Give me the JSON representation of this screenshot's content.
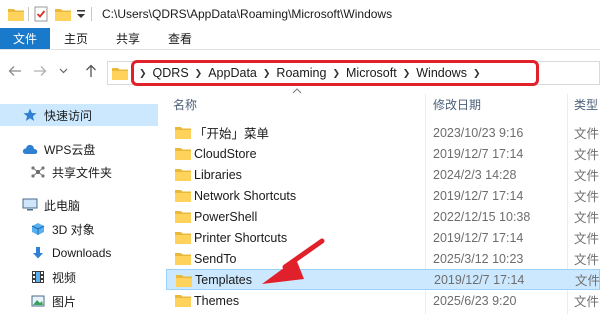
{
  "titlebar": {
    "title": "C:\\Users\\QDRS\\AppData\\Roaming\\Microsoft\\Windows",
    "icons": [
      "folder-icon",
      "properties-check-icon",
      "new-folder-icon",
      "customize-dropdown-icon"
    ]
  },
  "ribbon": {
    "tabs": [
      {
        "label": "文件",
        "active": true
      },
      {
        "label": "主页"
      },
      {
        "label": "共享"
      },
      {
        "label": "查看"
      }
    ]
  },
  "navigation": {
    "back_icon": "arrow-left-icon",
    "forward_icon": "arrow-right-icon",
    "recent_icon": "chevron-down-icon",
    "up_icon": "arrow-up-icon"
  },
  "address": {
    "crumbs": [
      "QDRS",
      "AppData",
      "Roaming",
      "Microsoft",
      "Windows"
    ],
    "highlight_color": "#e0202a"
  },
  "sidebar": {
    "items": [
      {
        "label": "快速访问",
        "icon": "star-icon"
      },
      {
        "label": "WPS云盘",
        "icon": "cloud-icon"
      },
      {
        "label": "共享文件夹",
        "icon": "share-icon"
      },
      {
        "label": "此电脑",
        "icon": "computer-icon"
      },
      {
        "label": "3D 对象",
        "icon": "cube-icon"
      },
      {
        "label": "Downloads",
        "icon": "download-icon"
      },
      {
        "label": "视频",
        "icon": "video-icon"
      },
      {
        "label": "图片",
        "icon": "picture-icon"
      }
    ]
  },
  "columns": {
    "name": "名称",
    "date": "修改日期",
    "type": "类型"
  },
  "files": [
    {
      "name": "「开始」菜单",
      "date": "2023/10/23 9:16",
      "type": "文件"
    },
    {
      "name": "CloudStore",
      "date": "2019/12/7 17:14",
      "type": "文件"
    },
    {
      "name": "Libraries",
      "date": "2024/2/3 14:28",
      "type": "文件"
    },
    {
      "name": "Network Shortcuts",
      "date": "2019/12/7 17:14",
      "type": "文件"
    },
    {
      "name": "PowerShell",
      "date": "2022/12/15 10:38",
      "type": "文件"
    },
    {
      "name": "Printer Shortcuts",
      "date": "2019/12/7 17:14",
      "type": "文件"
    },
    {
      "name": "SendTo",
      "date": "2025/3/12 10:23",
      "type": "文件"
    },
    {
      "name": "Templates",
      "date": "2019/12/7 17:14",
      "type": "文件",
      "selected": true
    },
    {
      "name": "Themes",
      "date": "2025/6/23 9:20",
      "type": "文件"
    }
  ],
  "colors": {
    "accent": "#1979ca",
    "selection": "#cce8ff",
    "folder": "#ffd25c",
    "annotation": "#e0202a"
  }
}
